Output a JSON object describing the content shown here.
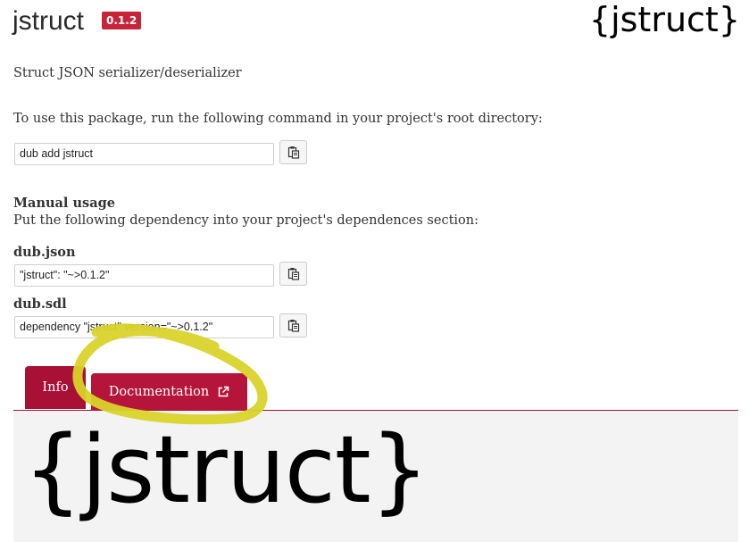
{
  "header": {
    "package_name": "jstruct",
    "version": "0.1.2",
    "logo_text": "{jstruct}"
  },
  "description": "Struct JSON serializer/deserializer",
  "install": {
    "instruction": "To use this package, run the following command in your project's root directory:",
    "command": "dub add jstruct"
  },
  "manual": {
    "heading": "Manual usage",
    "instruction": "Put the following dependency into your project's dependences section:",
    "json_label": "dub.json",
    "json_value": "\"jstruct\": \"~>0.1.2\"",
    "sdl_label": "dub.sdl",
    "sdl_value": "dependency \"jstruct\" version=\"~>0.1.2\""
  },
  "tabs": {
    "info": "Info",
    "documentation": "Documentation"
  },
  "panel": {
    "logo_text": "{jstruct}"
  },
  "icons": {
    "copy": "clipboard-icon",
    "external": "external-link-icon"
  },
  "colors": {
    "accent": "#b5153a",
    "badge": "#c7243a",
    "highlight": "#d9d32a"
  }
}
